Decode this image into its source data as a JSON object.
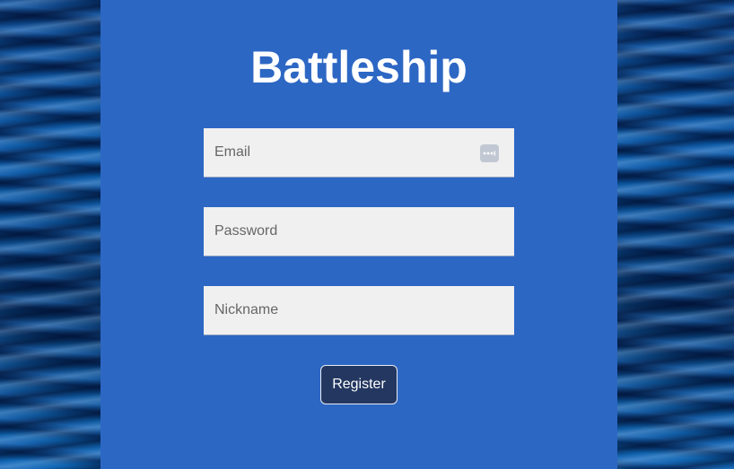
{
  "app": {
    "title": "Battleship"
  },
  "form": {
    "email": {
      "placeholder": "Email",
      "value": ""
    },
    "password": {
      "placeholder": "Password",
      "value": ""
    },
    "nickname": {
      "placeholder": "Nickname",
      "value": ""
    },
    "register_label": "Register"
  },
  "icons": {
    "email_autofill": "password-manager-icon"
  },
  "colors": {
    "panel": "#2d67c4",
    "field_background": "#f0f0f0",
    "button_background": "#233760",
    "title_text": "#ffffff",
    "water_background": "#0a4a8f"
  }
}
